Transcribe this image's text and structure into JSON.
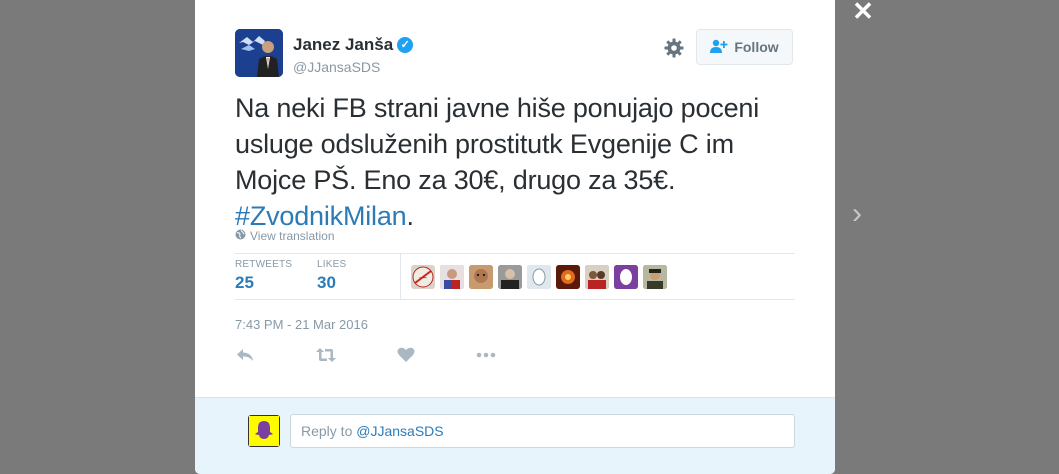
{
  "overlay": {
    "close_label": "✕",
    "next_label": "›"
  },
  "tweet": {
    "author_name": "Janez Janša",
    "verified_icon": "✓",
    "handle": "@JJansaSDS",
    "follow_label": "Follow",
    "text": "Na neki FB strani javne hiše ponujajo poceni usluge odsluženih prostitutk Evgenije C im Mojce PŠ. Eno za 30€, drugo za 35€. ",
    "hashtag": "#ZvodnikMilan",
    "text_end": ".",
    "view_translation": "View translation",
    "retweets_label": "RETWEETS",
    "retweets_count": "25",
    "likes_label": "LIKES",
    "likes_count": "30",
    "timestamp": "7:43 PM - 21 Mar 2016"
  },
  "likers": [
    {
      "name": "liker-1",
      "color": "#d9d4c7"
    },
    {
      "name": "liker-2",
      "color": "#a33a4a"
    },
    {
      "name": "liker-3",
      "color": "#a86d3c"
    },
    {
      "name": "liker-4",
      "color": "#3a3a3a"
    },
    {
      "name": "liker-5",
      "color": "#8a9aa8"
    },
    {
      "name": "liker-6",
      "color": "#c2501a"
    },
    {
      "name": "liker-7",
      "color": "#6b4a2e"
    },
    {
      "name": "liker-8",
      "color": "#7b3fa0"
    },
    {
      "name": "liker-9",
      "color": "#4a4a2a"
    }
  ],
  "reply": {
    "prefix": "Reply to ",
    "mention": "@JJansaSDS"
  },
  "colors": {
    "accent": "#1da1f2",
    "link": "#2b7bb9",
    "muted": "#8899a6"
  }
}
